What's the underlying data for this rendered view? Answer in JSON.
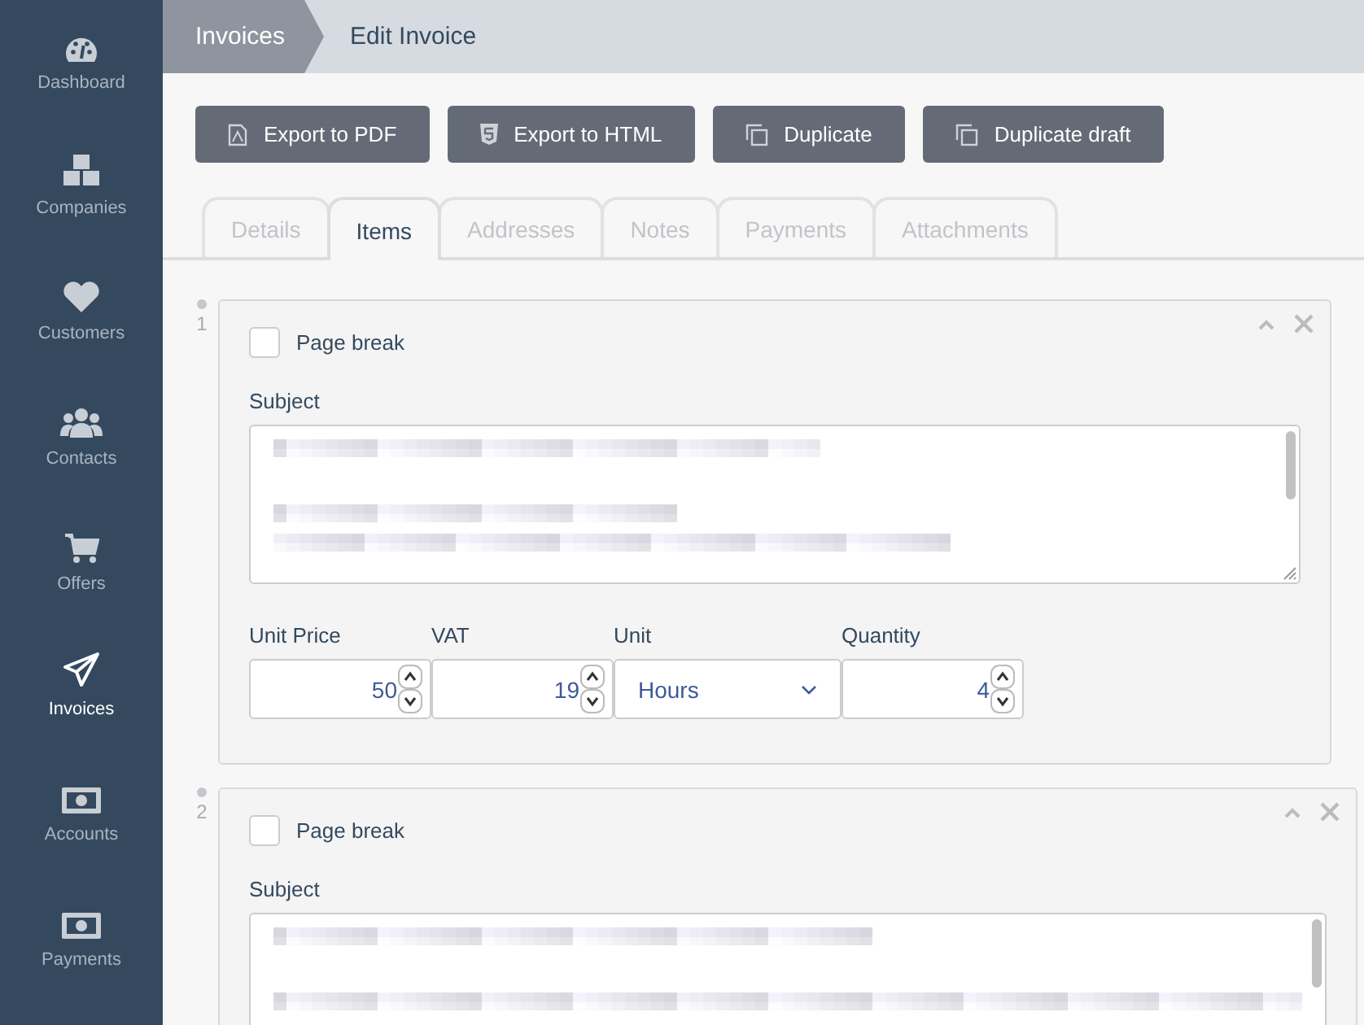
{
  "sidebar": {
    "items": [
      {
        "label": "Dashboard",
        "kind": "gauge",
        "selected": false
      },
      {
        "label": "Companies",
        "kind": "cubes",
        "selected": false
      },
      {
        "label": "Customers",
        "kind": "heart",
        "selected": false
      },
      {
        "label": "Contacts",
        "kind": "users",
        "selected": false
      },
      {
        "label": "Offers",
        "kind": "cart",
        "selected": false
      },
      {
        "label": "Invoices",
        "kind": "plane",
        "selected": true
      },
      {
        "label": "Accounts",
        "kind": "money",
        "selected": false
      },
      {
        "label": "Payments",
        "kind": "money",
        "selected": false
      }
    ]
  },
  "breadcrumb": [
    {
      "label": "Invoices"
    },
    {
      "label": "Edit Invoice"
    }
  ],
  "actions": [
    {
      "label": "Export to PDF",
      "kind": "pdf"
    },
    {
      "label": "Export to HTML",
      "kind": "html"
    },
    {
      "label": "Duplicate",
      "kind": "copy"
    },
    {
      "label": "Duplicate draft",
      "kind": "copy"
    }
  ],
  "tabs": [
    {
      "label": "Details",
      "selected": false
    },
    {
      "label": "Items",
      "selected": true
    },
    {
      "label": "Addresses",
      "selected": false
    },
    {
      "label": "Notes",
      "selected": false
    },
    {
      "label": "Payments",
      "selected": false
    },
    {
      "label": "Attachments",
      "selected": false
    }
  ],
  "items": [
    {
      "number": "1",
      "page_break": {
        "label": "Page break",
        "checked": false
      },
      "subject_label": "Subject",
      "fields": [
        {
          "label": "Unit Price",
          "kind": "number",
          "value": "50"
        },
        {
          "label": "VAT",
          "kind": "number",
          "value": "19"
        },
        {
          "label": "Unit",
          "kind": "select",
          "value": "Hours"
        },
        {
          "label": "Quantity",
          "kind": "number",
          "value": "4"
        }
      ]
    },
    {
      "number": "2",
      "page_break": {
        "label": "Page break",
        "checked": false
      },
      "subject_label": "Subject"
    }
  ]
}
